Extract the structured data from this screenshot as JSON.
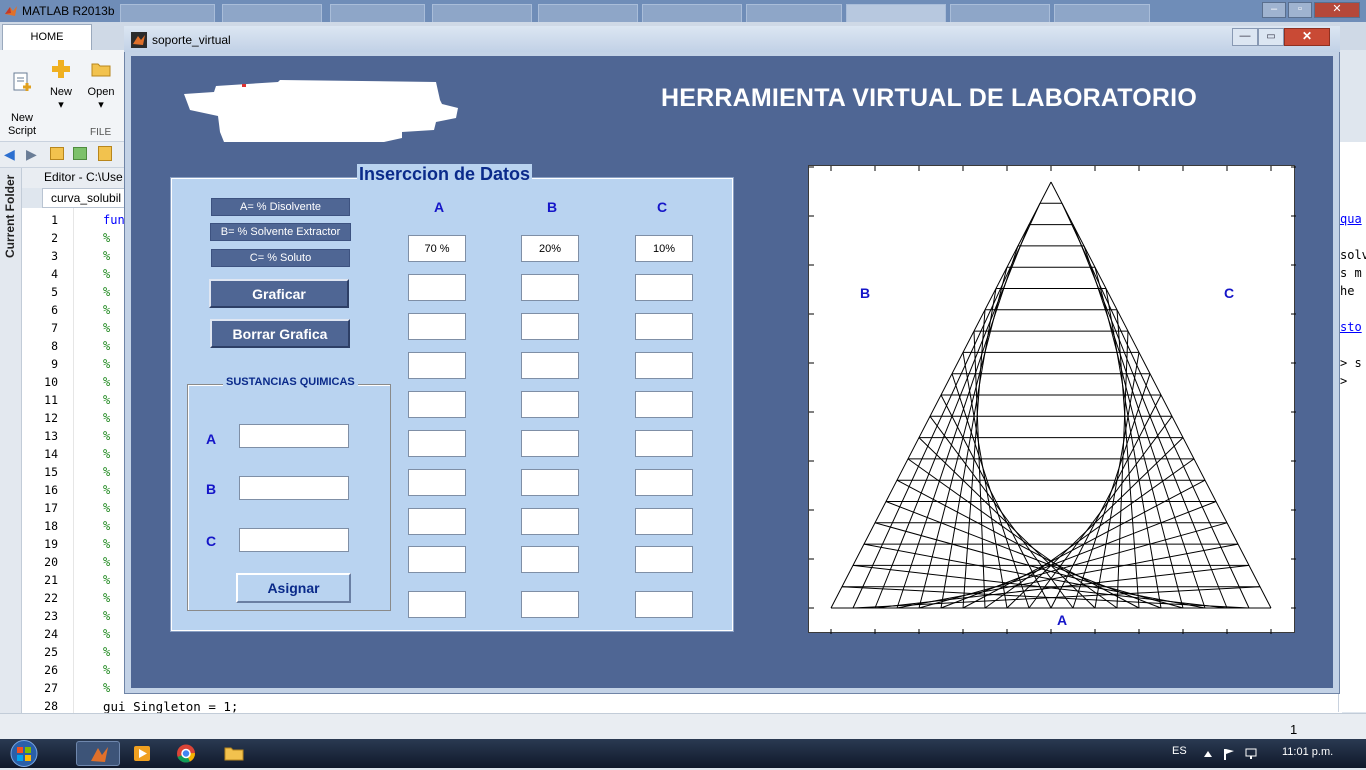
{
  "matlab": {
    "window_title": "MATLAB R2013b",
    "home_tab": "HOME",
    "ribbon": {
      "new_script": "New\nScript",
      "new": "New",
      "open": "Open",
      "file_group": "FILE"
    },
    "current_folder": "Current Folder",
    "editor_title": "Editor - C:\\Use",
    "editor_tab": "curva_solubil",
    "line_numbers": [
      "1",
      "2",
      "3",
      "4",
      "5",
      "6",
      "7",
      "8",
      "9",
      "10",
      "11",
      "12",
      "13",
      "14",
      "15",
      "16",
      "17",
      "18",
      "19",
      "20",
      "21",
      "22",
      "23",
      "24",
      "25",
      "26",
      "27",
      "28"
    ],
    "code_first": "fun",
    "code_last": "gui_Singleton = 1;",
    "right_peek": [
      "qua",
      "solv",
      "s m",
      "he ",
      "sto",
      "> s",
      ">"
    ],
    "cursor_readout": "1"
  },
  "taskbar": {
    "language": "ES",
    "clock": "11:01 p.m."
  },
  "figure": {
    "window_title": "soporte_virtual",
    "main_title": "HERRAMIENTA VIRTUAL DE LABORATORIO",
    "panel_title": "Inserccion de Datos",
    "legend": [
      "A= % Disolvente",
      "B= % Solvente Extractor",
      "C= % Soluto"
    ],
    "buttons": {
      "graficar": "Graficar",
      "borrar": "Borrar Grafica",
      "asignar": "Asignar"
    },
    "columns": [
      "A",
      "B",
      "C"
    ],
    "table": [
      [
        "70 %",
        "20%",
        "10%"
      ],
      [
        "",
        "",
        ""
      ],
      [
        "",
        "",
        ""
      ],
      [
        "",
        "",
        ""
      ],
      [
        "",
        "",
        ""
      ],
      [
        "",
        "",
        ""
      ],
      [
        "",
        "",
        ""
      ],
      [
        "",
        "",
        ""
      ],
      [
        "",
        "",
        ""
      ],
      [
        "",
        "",
        ""
      ]
    ],
    "sustancias": {
      "title": "SUSTANCIAS QUIMICAS",
      "labels": [
        "A",
        "B",
        "C"
      ],
      "values": [
        "",
        "",
        ""
      ]
    },
    "plot": {
      "label_bottom": "A",
      "label_left": "B",
      "label_right": "C",
      "grid_divisions": 20
    }
  },
  "colors": {
    "figure_background": "#4f6694",
    "panel_background": "#b9d3f0",
    "label_blue": "#1515c8",
    "title_blue": "#0a2a8a"
  }
}
